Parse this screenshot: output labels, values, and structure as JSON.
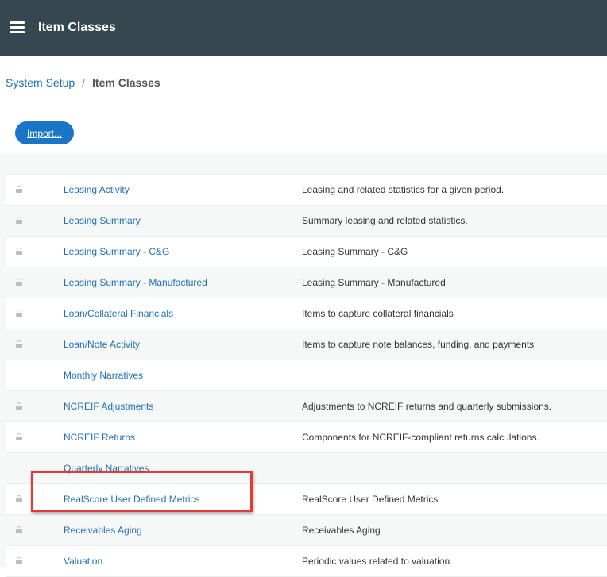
{
  "header": {
    "title": "Item Classes",
    "menu_icon": "hamburger-menu-icon",
    "background_color": "#37474f"
  },
  "breadcrumb": {
    "parent": "System Setup",
    "separator": "/",
    "current": "Item Classes"
  },
  "toolbar": {
    "import_label": "Import...",
    "accent_color": "#1b75c7"
  },
  "rows": [
    {
      "locked": true,
      "name": "Leasing Activity",
      "description": "Leasing and related statistics for a given period."
    },
    {
      "locked": true,
      "name": "Leasing Summary",
      "description": "Summary leasing and related statistics."
    },
    {
      "locked": true,
      "name": "Leasing Summary - C&G",
      "description": "Leasing Summary - C&G"
    },
    {
      "locked": true,
      "name": "Leasing Summary - Manufactured",
      "description": "Leasing Summary - Manufactured"
    },
    {
      "locked": true,
      "name": "Loan/Collateral Financials",
      "description": "Items to capture collateral financials"
    },
    {
      "locked": true,
      "name": "Loan/Note Activity",
      "description": "Items to capture note balances, funding, and payments"
    },
    {
      "locked": false,
      "name": "Monthly Narratives",
      "description": ""
    },
    {
      "locked": true,
      "name": "NCREIF Adjustments",
      "description": "Adjustments to NCREIF returns and quarterly submissions."
    },
    {
      "locked": true,
      "name": "NCREIF Returns",
      "description": "Components for NCREIF-compliant returns calculations."
    },
    {
      "locked": false,
      "name": "Quarterly Narratives",
      "description": ""
    },
    {
      "locked": true,
      "name": "RealScore User Defined Metrics",
      "description": "RealScore User Defined Metrics",
      "highlighted": true
    },
    {
      "locked": true,
      "name": "Receivables Aging",
      "description": "Receivables Aging"
    },
    {
      "locked": true,
      "name": "Valuation",
      "description": "Periodic values related to valuation."
    }
  ],
  "icons": {
    "lock": "lock-icon"
  },
  "highlight_color": "#e53935"
}
